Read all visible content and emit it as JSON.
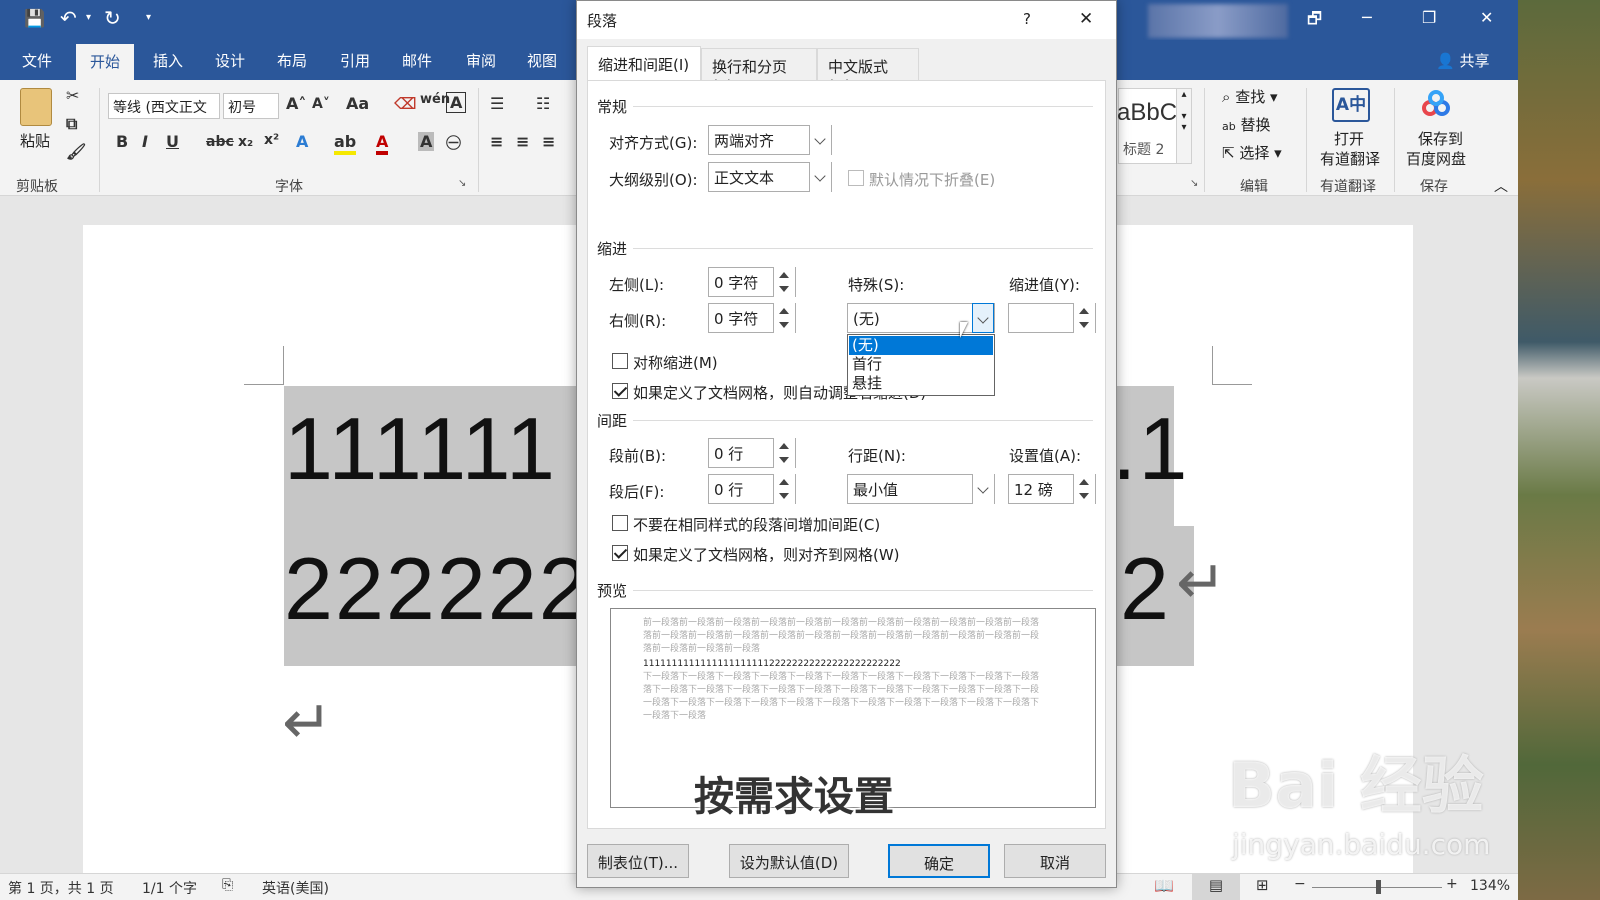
{
  "qat": {
    "save": "💾",
    "undo": "↶",
    "redo": "↻",
    "more": "▾"
  },
  "window": {
    "share": "共享",
    "restore": "🗗",
    "min": "─",
    "max": "❐",
    "close": "✕"
  },
  "tabs": [
    "文件",
    "开始",
    "插入",
    "设计",
    "布局",
    "引用",
    "邮件",
    "审阅",
    "视图"
  ],
  "ribbon": {
    "paste": "粘贴",
    "clipboard": "剪贴板",
    "font": "字体",
    "font_name": "等线 (西文正文",
    "font_size": "初号",
    "style_preview": "aBbC",
    "style_name": "标题 2",
    "find": "查找",
    "replace": "替换",
    "select": "选择",
    "edit": "编辑",
    "youdao_open": "打开",
    "youdao_translate": "有道翻译",
    "youdao_group": "有道翻译",
    "baidu_save": "保存到",
    "baidu_disk": "百度网盘",
    "save_group": "保存"
  },
  "document": {
    "line1": "111111",
    "line1_tail": ".1",
    "line2": "222222",
    "line2_tail": "2",
    "return_mark": "↵"
  },
  "status": {
    "page": "第 1 页，共 1 页",
    "words": "1/1 个字",
    "lang": "英语(美国)",
    "zoom": "134%"
  },
  "dialog": {
    "title": "段落",
    "help": "?",
    "close": "✕",
    "tabs": [
      "缩进和间距(I)",
      "换行和分页(P)",
      "中文版式(H)"
    ],
    "general": "常规",
    "align_label": "对齐方式(G):",
    "align_value": "两端对齐",
    "outline_label": "大纲级别(O):",
    "outline_value": "正文文本",
    "collapse_label": "默认情况下折叠(E)",
    "indent": "缩进",
    "left_label": "左侧(L):",
    "left_value": "0 字符",
    "right_label": "右侧(R):",
    "right_value": "0 字符",
    "special_label": "特殊(S):",
    "special_value": "(无)",
    "indent_by_label": "缩进值(Y):",
    "indent_by_value": "",
    "mirror_label": "对称缩进(M)",
    "auto_adjust_label": "如果定义了文档网格，则自动调整右缩进(D)",
    "special_options": [
      "(无)",
      "首行",
      "悬挂"
    ],
    "spacing": "间距",
    "before_label": "段前(B):",
    "before_value": "0 行",
    "after_label": "段后(F):",
    "after_value": "0 行",
    "line_label": "行距(N):",
    "line_value": "最小值",
    "at_label": "设置值(A):",
    "at_value": "12 磅",
    "no_space_label": "不要在相同样式的段落间增加间距(C)",
    "snap_grid_label": "如果定义了文档网格，则对齐到网格(W)",
    "preview": "预览",
    "preview_lines": [
      "前一段落前一段落前一段落前一段落前一段落前一段落前一段落前一段落前一段落前一段落前一段落",
      "落前一段落前一段落前一段落前一段落前一段落前一段落前一段落前一段落前一段落前一段落前一段",
      "落前一段落前一段落前一段落",
      "111111111111111111111122222222222222222222222",
      "下一段落下一段落下一段落下一段落下一段落下一段落下一段落下一段落下一段落下一段落下一段落",
      "落下一段落下一段落下一段落下一段落下一段落下一段落下一段落下一段落下一段落下一段落下一段",
      "一段落下一段落下一段落下一段落下一段落下一段落下一段落下一段落下一段落下一段落下一段落下",
      "一段落下一段落"
    ],
    "tabs_button": "制表位(T)...",
    "default_button": "设为默认值(D)",
    "ok": "确定",
    "cancel": "取消"
  },
  "caption": "按需求设置",
  "watermark": {
    "main": "Bai 经验",
    "sub": "jingyan.baidu.com"
  }
}
